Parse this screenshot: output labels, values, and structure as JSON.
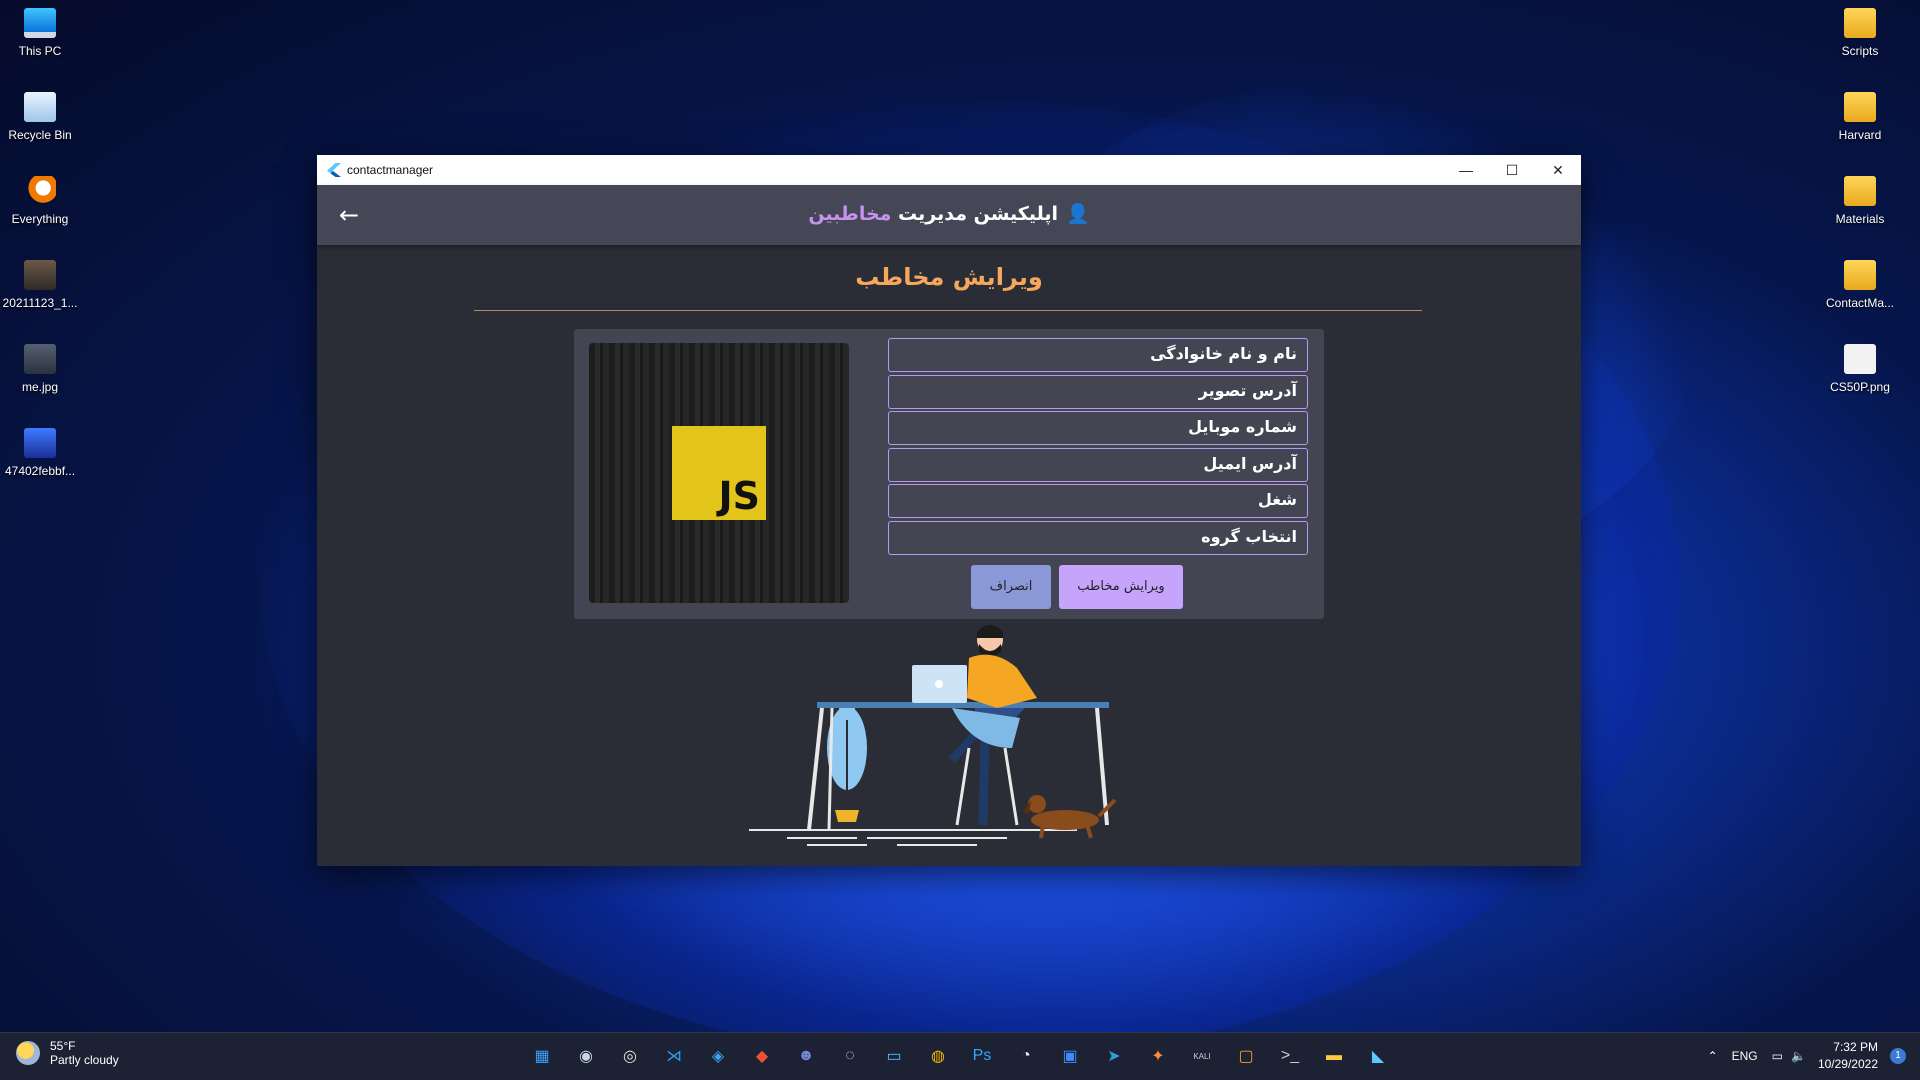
{
  "desktop": {
    "left_icons": [
      {
        "label": "This PC",
        "icon": "computer-icon"
      },
      {
        "label": "Recycle Bin",
        "icon": "recycle-bin-icon"
      },
      {
        "label": "Everything",
        "icon": "everything-search-icon"
      },
      {
        "label": "20211123_1...",
        "icon": "image-file-icon"
      },
      {
        "label": "me.jpg",
        "icon": "image-file-icon"
      },
      {
        "label": "47402febbf...",
        "icon": "image-file-icon"
      }
    ],
    "right_icons": [
      {
        "label": "Scripts",
        "icon": "folder-icon"
      },
      {
        "label": "Harvard",
        "icon": "folder-icon"
      },
      {
        "label": "Materials",
        "icon": "folder-icon"
      },
      {
        "label": "ContactMa...",
        "icon": "folder-icon"
      },
      {
        "label": "CS50P.png",
        "icon": "image-file-icon"
      }
    ]
  },
  "window": {
    "title": "contactmanager",
    "controls": {
      "minimize": "—",
      "maximize": "☐",
      "close": "✕"
    }
  },
  "appbar": {
    "title_main": "اپلیکیشن مدیریت",
    "title_accent": "مخاطبین",
    "back": "←",
    "person_icon": "👤"
  },
  "page": {
    "title": "ویرایش مخاطب"
  },
  "form": {
    "fields": [
      {
        "placeholder": "نام و نام خانوادگی"
      },
      {
        "placeholder": "آدرس تصویر"
      },
      {
        "placeholder": "شماره موبایل"
      },
      {
        "placeholder": "آدرس ایمیل"
      },
      {
        "placeholder": "شغل"
      },
      {
        "placeholder": "انتخاب گروه"
      }
    ],
    "submit_label": "ویرایش مخاطب",
    "cancel_label": "انصراف",
    "photo_text": "JS"
  },
  "taskbar": {
    "weather_temp": "55°F",
    "weather_desc": "Partly cloudy",
    "language": "ENG",
    "time": "7:32 PM",
    "date": "10/29/2022",
    "notification_count": "1",
    "apps": [
      {
        "icon": "windows-start-icon",
        "glyph": "▦",
        "color": "#3aa0ff"
      },
      {
        "icon": "steam-icon",
        "glyph": "◉",
        "color": "#c7d5e0"
      },
      {
        "icon": "obs-icon",
        "glyph": "◎",
        "color": "#e0e0e0"
      },
      {
        "icon": "vscode-icon",
        "glyph": "⋊",
        "color": "#2f9bf0"
      },
      {
        "icon": "browser-icon",
        "glyph": "◈",
        "color": "#3aa7e8"
      },
      {
        "icon": "git-icon",
        "glyph": "◆",
        "color": "#f05033"
      },
      {
        "icon": "discord-icon",
        "glyph": "☻",
        "color": "#7289da"
      },
      {
        "icon": "aperture-icon",
        "glyph": "◌",
        "color": "#dddddd"
      },
      {
        "icon": "monitor-icon",
        "glyph": "▭",
        "color": "#4fc3f7"
      },
      {
        "icon": "chrome-icon",
        "glyph": "◍",
        "color": "#f4b400"
      },
      {
        "icon": "photoshop-icon",
        "glyph": "Ps",
        "color": "#31a8ff"
      },
      {
        "icon": "app-icon",
        "glyph": "◔",
        "color": "#e8f0ff"
      },
      {
        "icon": "app-icon",
        "glyph": "▣",
        "color": "#3d8bff"
      },
      {
        "icon": "telegram-icon",
        "glyph": "➤",
        "color": "#2aa1da"
      },
      {
        "icon": "app-icon",
        "glyph": "✦",
        "color": "#ff8a3d"
      },
      {
        "icon": "kali-icon",
        "glyph": "KALI",
        "color": "#cccccc"
      },
      {
        "icon": "virtualbox-icon",
        "glyph": "▢",
        "color": "#f4a31a"
      },
      {
        "icon": "terminal-icon",
        "glyph": ">_",
        "color": "#cccccc"
      },
      {
        "icon": "file-explorer-icon",
        "glyph": "▬",
        "color": "#ffc83d"
      },
      {
        "icon": "flutter-icon",
        "glyph": "◣",
        "color": "#5ac8fa"
      }
    ]
  }
}
